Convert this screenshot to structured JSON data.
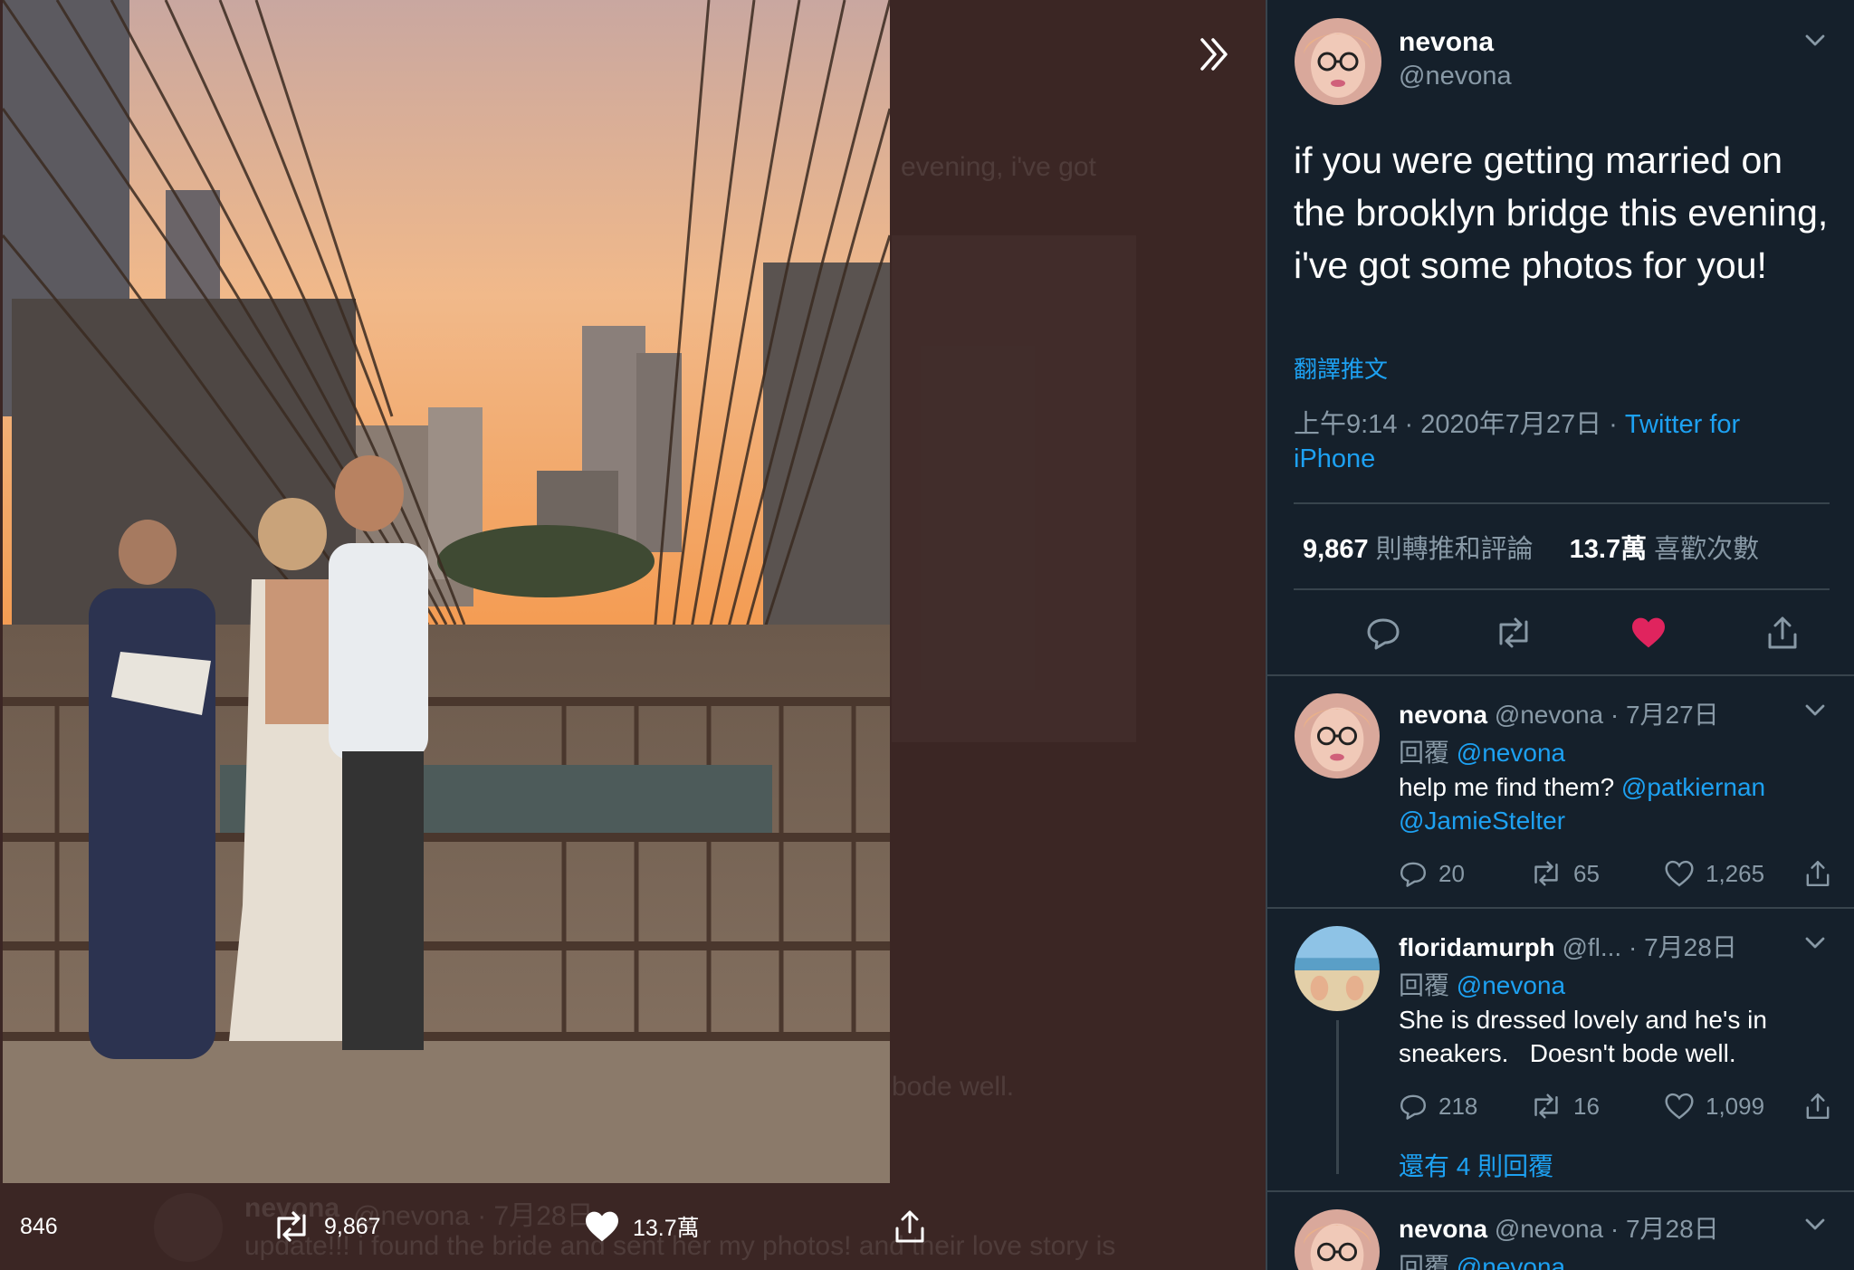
{
  "viewer": {
    "background_color": "#3b2624",
    "ghost_texts": {
      "evening_fragment": "evening, i've got",
      "bode_fragment": "bode well.",
      "reply_name": "nevona",
      "reply_handle": "@nevona · 7月28日",
      "update_fragment": "update!!! i found the bride and sent her my photos! and their love story is"
    },
    "photo_actions": {
      "reply_count": "846",
      "retweet_count": "9,867",
      "like_count": "13.7萬"
    }
  },
  "tweet": {
    "author_name": "nevona",
    "author_handle": "@nevona",
    "text": "if you were getting married on the brooklyn bridge this evening, i've got some photos for you!",
    "translate_label": "翻譯推文",
    "timestamp": "上午9:14 · 2020年7月27日 · ",
    "source": "Twitter for iPhone",
    "stats": {
      "retweets_value": "9,867",
      "retweets_label": "則轉推和評論",
      "likes_value": "13.7萬",
      "likes_label": "喜歡次數"
    },
    "liked": true,
    "like_color": "#e0245e"
  },
  "replies": [
    {
      "name": "nevona",
      "handle_date": "@nevona · 7月27日",
      "reply_to_prefix": "回覆",
      "reply_to_handle": "@nevona",
      "text_plain": "help me find them? ",
      "mention_1": "@patkiernan",
      "mention_2": "@JamieStelter",
      "replies": "20",
      "retweets": "65",
      "likes": "1,265"
    },
    {
      "name": "floridamurph",
      "handle_date": "@fl... · 7月28日",
      "reply_to_prefix": "回覆",
      "reply_to_handle": "@nevona",
      "text": "She is dressed lovely and he's in sneakers.   Doesn't bode well.",
      "replies": "218",
      "retweets": "16",
      "likes": "1,099",
      "more_replies": "還有 4 則回覆"
    },
    {
      "name": "nevona",
      "handle_date": "@nevona · 7月28日",
      "reply_to_prefix": "回覆",
      "reply_to_handle": "@nevona"
    }
  ],
  "colors": {
    "panel_bg": "#15202b",
    "accent": "#1da1f2",
    "muted": "#8899a6",
    "divider": "#38444d"
  }
}
